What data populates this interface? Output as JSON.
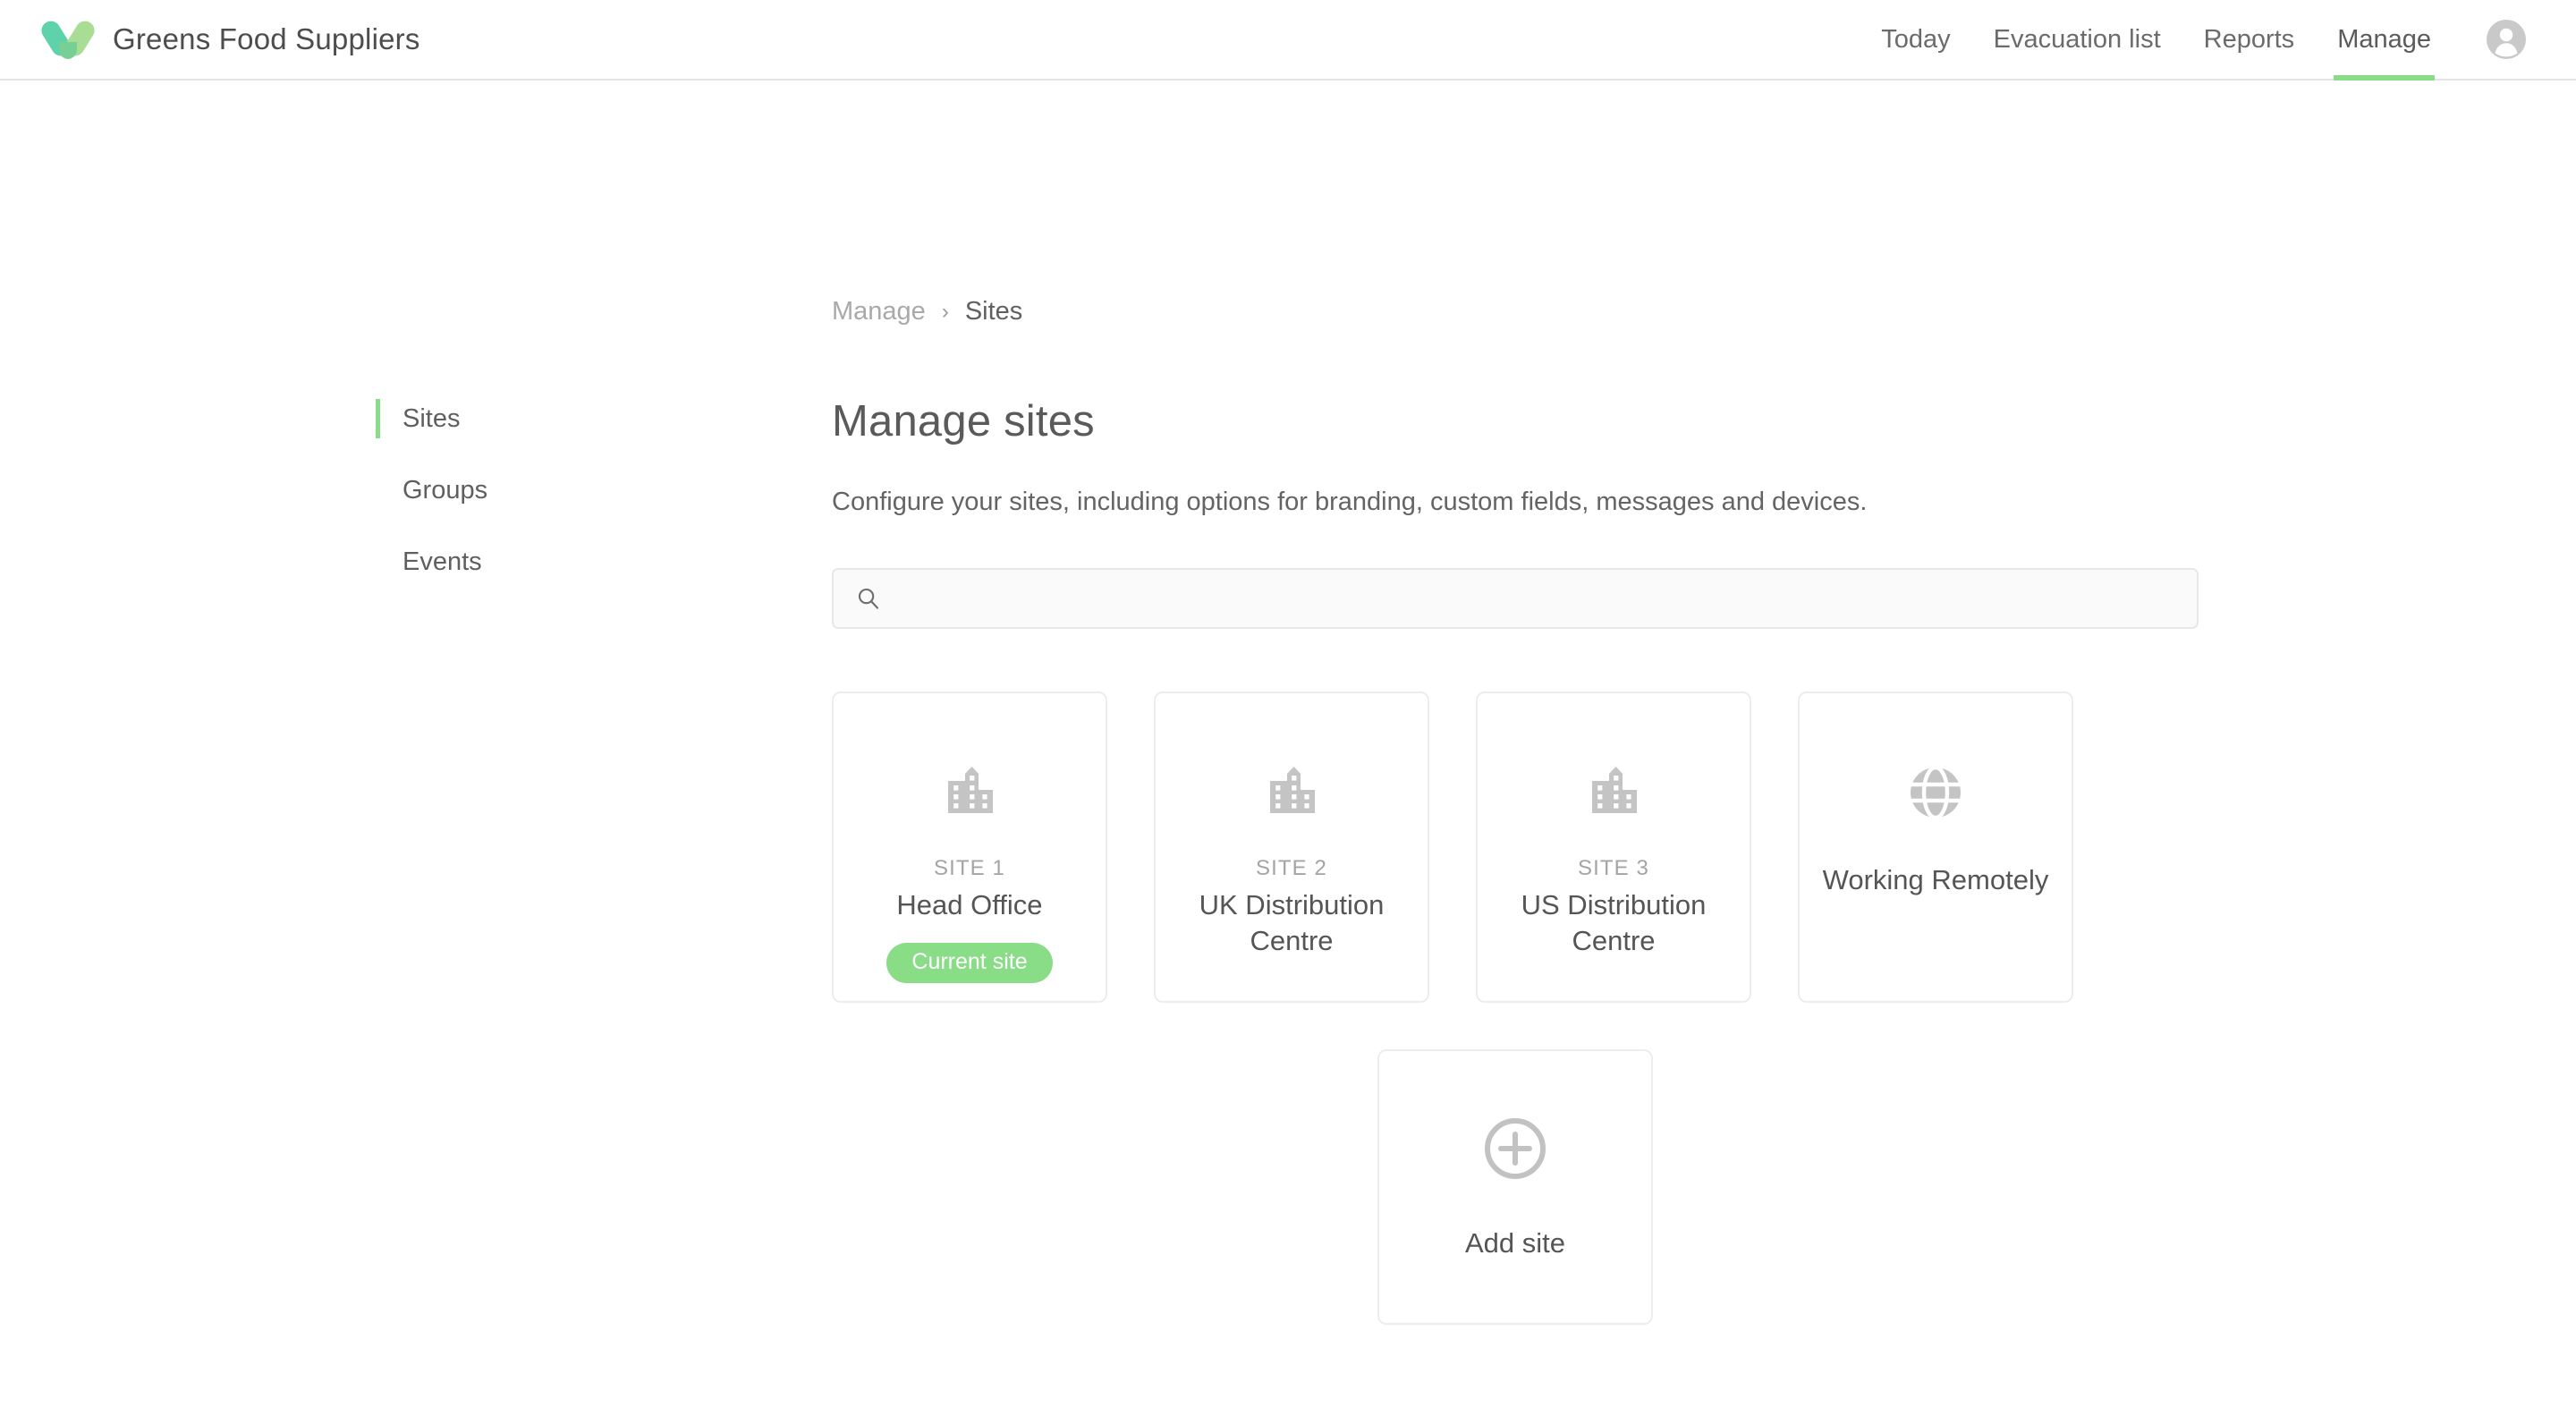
{
  "header": {
    "brand_name": "Greens Food Suppliers",
    "logo_icon": "heart-check-logo-icon",
    "logo_colors": {
      "left": "#5ed3ab",
      "right": "#a9dd96",
      "overlap": "#77cf93"
    },
    "nav": [
      {
        "label": "Today",
        "active": false
      },
      {
        "label": "Evacuation list",
        "active": false
      },
      {
        "label": "Reports",
        "active": false
      },
      {
        "label": "Manage",
        "active": true
      }
    ],
    "account_icon": "user-account-icon",
    "active_underline_color": "#8bdc89"
  },
  "breadcrumb": {
    "parent": "Manage",
    "separator": "›",
    "current": "Sites"
  },
  "sidebar": {
    "items": [
      {
        "label": "Sites",
        "active": true
      },
      {
        "label": "Groups",
        "active": false
      },
      {
        "label": "Events",
        "active": false
      }
    ],
    "active_marker_color": "#8bdc89"
  },
  "main": {
    "title": "Manage sites",
    "subtitle": "Configure your sites, including options for branding, custom fields, messages and devices.",
    "search": {
      "value": "",
      "placeholder": "",
      "icon": "search-icon"
    },
    "sites": [
      {
        "site_label": "SITE 1",
        "name": "Head Office",
        "icon": "office-building-icon",
        "badge": "Current site",
        "badge_color": "#89dd87"
      },
      {
        "site_label": "SITE 2",
        "name": "UK Distribution Centre",
        "icon": "office-building-icon",
        "badge": "",
        "badge_color": ""
      },
      {
        "site_label": "SITE 3",
        "name": "US Distribution Centre",
        "icon": "office-building-icon",
        "badge": "",
        "badge_color": ""
      },
      {
        "site_label": "",
        "name": "Working Remotely",
        "icon": "globe-icon",
        "badge": "",
        "badge_color": ""
      }
    ],
    "add_site": {
      "label": "Add site",
      "icon": "plus-circle-icon"
    }
  }
}
